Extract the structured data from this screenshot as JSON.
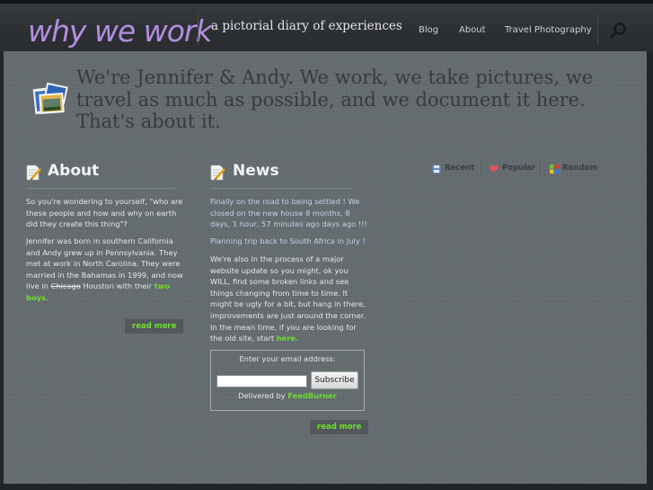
{
  "header": {
    "logo": "why we work",
    "tagline": "a pictorial diary of experiences",
    "nav": [
      {
        "label": "Blog"
      },
      {
        "label": "About"
      },
      {
        "label": "Travel Photography"
      }
    ],
    "search_icon": "search-icon"
  },
  "intro": {
    "icon": "photo-stack-icon",
    "text": "We're Jennifer & Andy. We work, we take pictures, we travel as much as possible, and we document it here. That's about it."
  },
  "about": {
    "title": "About",
    "icon": "notepad-pencil-icon",
    "para1": "So you're wondering to yourself, \"who are these people and how and why on earth did they create this thing\"?",
    "para2_a": "Jennifer was born in southern California and Andy grew up in Pennsylvania. They met at work in North Carolina. They were married in the Bahamas in 1999, and now live in ",
    "para2_strike": "Chicago",
    "para2_b": " Houston with their ",
    "para2_link": "two boys",
    "para2_end": ".",
    "read_more": "read more"
  },
  "news": {
    "title": "News",
    "icon": "notepad-pencil-icon",
    "item1": "Finally on the road to being settled ! We closed on the new house 8 months, 8 days, 1 hour, 57 minutes ago days ago !!!",
    "item2": "Planning trip back to South Africa in July !",
    "para_a": "We're also in the process of a major website update so you might, ok you WILL, find some broken links and see things changing from time to time. It might be ugly for a bit, but hang in there, improvements are just around the corner. In the mean time, if you are looking for the old site, start ",
    "para_link": "here",
    "para_end": ".",
    "subscribe": {
      "label": "Enter your email address:",
      "input_value": "",
      "button": "Subscribe",
      "delivered_by": "Delivered by ",
      "delivered_link": "FeedBurner"
    },
    "read_more": "read more"
  },
  "posts_tabs": [
    {
      "label": "Recent",
      "icon": "floppy-disk-icon"
    },
    {
      "label": "Popular",
      "icon": "heart-icon"
    },
    {
      "label": "Random",
      "icon": "colored-squares-icon"
    }
  ],
  "colors": {
    "logo": "#b48ee0",
    "link": "#6de02b",
    "news_text": "#c6cfe8",
    "background": "#646b6f"
  }
}
